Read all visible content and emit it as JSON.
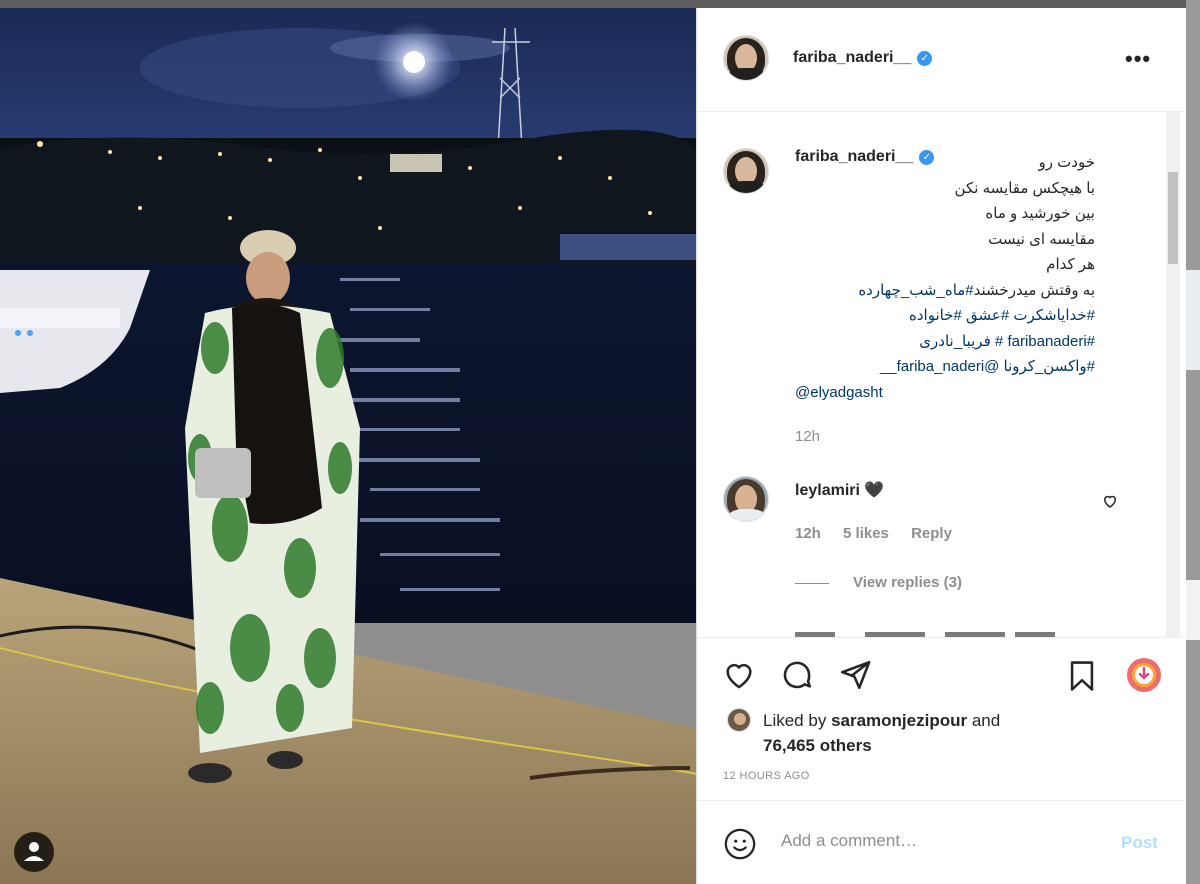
{
  "post": {
    "author": "fariba_naderi__",
    "verified_mark": "✓",
    "more_label": "•••",
    "caption_lines": [
      {
        "text": "خودت رو",
        "type": "plain"
      },
      {
        "text": "با هیچکس مقایسه نکن",
        "type": "plain"
      },
      {
        "text": "بین خورشید و ماه",
        "type": "plain"
      },
      {
        "text": "مقایسه ای نیست",
        "type": "plain"
      },
      {
        "text": "هر کدام",
        "type": "plain"
      }
    ],
    "caption_line6_plain": "به وقتش میدرخشند",
    "caption_line6_tag": "#ماه_شب_چهارده",
    "caption_tag_lines": [
      "#خدایاشکرت #عشق #خانواده",
      "#faribanaderi # فریبا_نادری",
      "#واکسن_کرونا @fariba_naderi__",
      "@elyadgasht"
    ],
    "caption_time": "12h"
  },
  "comment": {
    "user": "leylamiri",
    "text": "🖤",
    "time": "12h",
    "likes": "5 likes",
    "reply": "Reply",
    "view_replies": "View replies (3)"
  },
  "likes": {
    "prefix": "Liked by",
    "user": "saramonjezipour",
    "suffix": "and",
    "others": "76,465 others"
  },
  "timestamp": "12 HOURS AGO",
  "comment_box": {
    "placeholder": "Add a comment…",
    "post_label": "Post"
  },
  "icons": {
    "like": "heart-icon",
    "comment": "comment-icon",
    "share": "paper-plane-icon",
    "save": "bookmark-icon",
    "emoji": "smiley-icon",
    "tagged_user": "user-icon"
  },
  "colors": {
    "link": "#00376b",
    "verified": "#3897f0",
    "post_disabled": "#b2dffc",
    "muted": "#8e8e8e"
  }
}
